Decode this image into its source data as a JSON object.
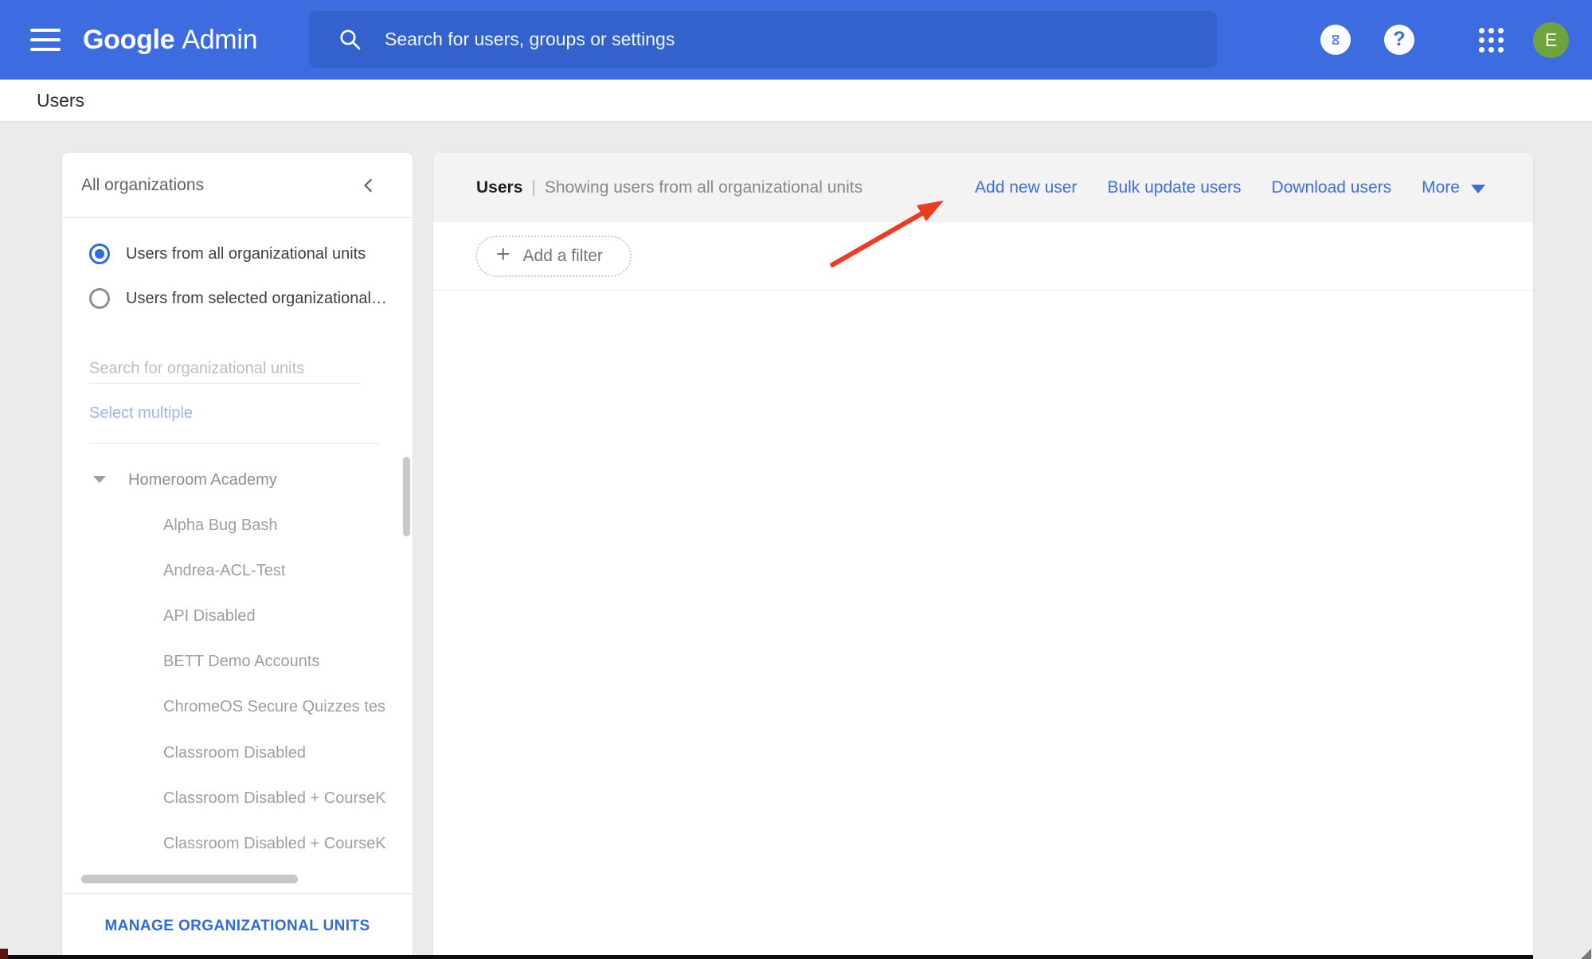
{
  "header": {
    "logo_google": "Google",
    "logo_admin": "Admin",
    "search_placeholder": "Search for users, groups or settings",
    "help_glyph": "?",
    "avatar_letter": "E",
    "icons": [
      "hamburger-menu-icon",
      "search-icon",
      "hourglass-icon",
      "help-icon",
      "apps-grid-icon",
      "avatar"
    ]
  },
  "breadcrumb": {
    "label": "Users"
  },
  "sidebar": {
    "title": "All organizations",
    "collapse_icon": "chevron-left-icon",
    "radios": [
      {
        "label": "Users from all organizational units",
        "selected": true
      },
      {
        "label": "Users from selected organizational…",
        "selected": false
      }
    ],
    "search_placeholder": "Search for organizational units",
    "select_multiple_label": "Select multiple",
    "tree": {
      "root": "Homeroom Academy",
      "children": [
        "Alpha Bug Bash",
        "Andrea-ACL-Test",
        "API Disabled",
        "BETT Demo Accounts",
        "ChromeOS Secure Quizzes tes",
        "Classroom Disabled",
        "Classroom Disabled + CourseK",
        "Classroom Disabled + CourseK"
      ]
    },
    "manage_button": "MANAGE ORGANIZATIONAL UNITS"
  },
  "main": {
    "title": "Users",
    "pipe": "|",
    "subtitle": "Showing users from all organizational units",
    "actions": [
      "Add new user",
      "Bulk update users",
      "Download users"
    ],
    "more_label": "More",
    "filter_plus_glyph": "+",
    "filter_label": "Add a filter"
  },
  "colors": {
    "header_blue": "#3c6ce0",
    "search_field_blue": "#3362cd",
    "link_blue": "#3b6fe0",
    "radio_blue": "#2a6ce8",
    "manage_blue": "#2e6bdf",
    "avatar_green": "#71a33c",
    "arrow_red": "#ee3b22",
    "page_bg": "#eaebeb",
    "panel_header_bg": "#f3f3f4"
  }
}
